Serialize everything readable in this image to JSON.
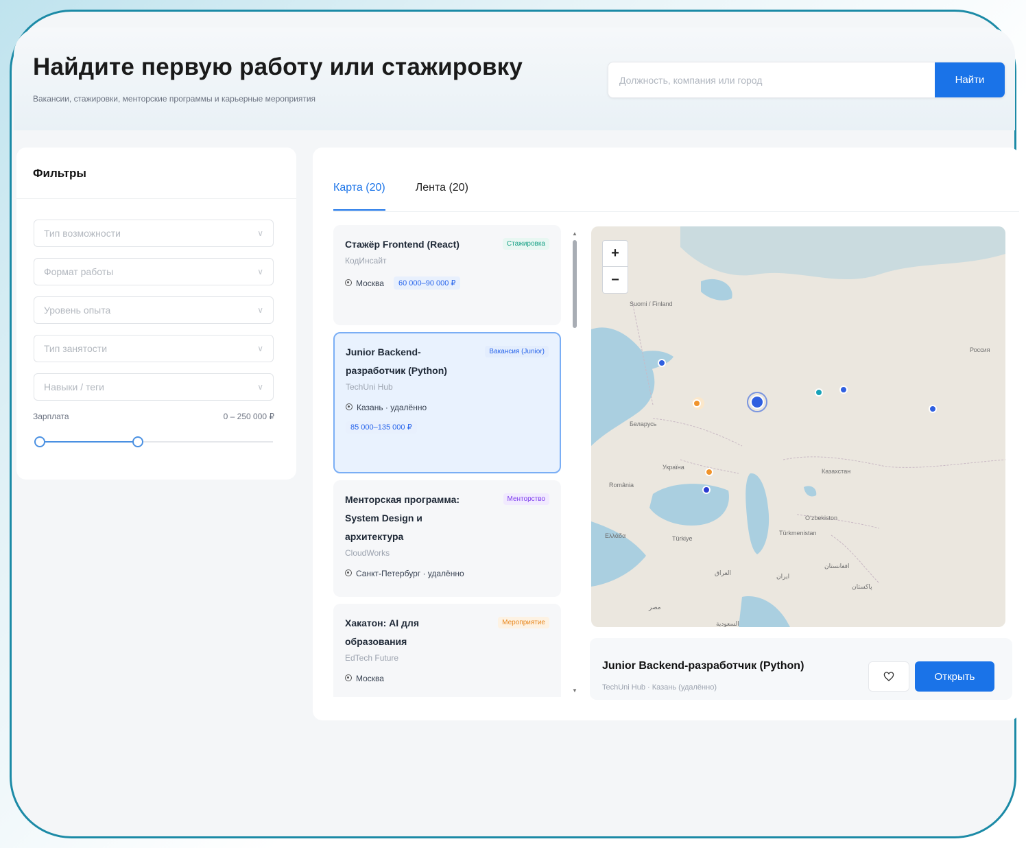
{
  "header": {
    "title": "Найдите первую работу или стажировку",
    "subtitle": "Вакансии, стажировки, менторские программы и карьерные мероприятия"
  },
  "search": {
    "placeholder": "Должность, компания или город",
    "button_label": "Найти"
  },
  "filters": {
    "title": "Фильтры",
    "selects": [
      {
        "placeholder": "Тип возможности"
      },
      {
        "placeholder": "Формат работы"
      },
      {
        "placeholder": "Уровень опыта"
      },
      {
        "placeholder": "Тип занятости"
      },
      {
        "placeholder": "Навыки / теги"
      }
    ],
    "salary": {
      "label": "Зарплата",
      "range_text": "0 – 250 000 ₽",
      "low_fraction": 0.0,
      "high_fraction": 0.42
    }
  },
  "tabs": [
    {
      "label": "Карта (20)",
      "active": true
    },
    {
      "label": "Лента (20)",
      "active": false
    }
  ],
  "listings": [
    {
      "title": "Стажёр Frontend (React)",
      "badge": "Стажировка",
      "company": "КодИнсайт",
      "location": "Москва",
      "salary": "60 000–90 000 ₽"
    },
    {
      "title": "Junior Backend-разработчик (Python)",
      "badge": "Вакансия (Junior)",
      "company": "TechUni Hub",
      "location": "Казань · удалённо",
      "salary": "85 000–135 000 ₽"
    },
    {
      "title": "Менторская программа: System Design и архитектура",
      "badge": "Менторство",
      "company": "CloudWorks",
      "location": "Санкт-Петербург · удалённо",
      "salary": ""
    },
    {
      "title": "Хакатон: AI для образования",
      "badge": "Мероприятие",
      "company": "EdTech Future",
      "location": "Москва",
      "salary": ""
    }
  ],
  "map": {
    "zoom_in": "+",
    "zoom_out": "−",
    "labels": [
      "Suomi / Finland",
      "Беларусь",
      "Україна",
      "România",
      "Türkiye",
      "Казахстан",
      "Oʻzbekiston",
      "Türkmenistan",
      "العراق",
      "ایران",
      "افغانستان",
      "پاکستان",
      "Россия",
      "Ελλάδα",
      "مصر",
      "السعودية"
    ],
    "colors": {
      "vacancy": "#2f5fe0",
      "internship": "#17a2b8",
      "event": "#f0932b",
      "water": "#aacfe0",
      "land": "#ebe7df"
    }
  },
  "selected": {
    "title": "Junior Backend-разработчик (Python)",
    "subtitle": "TechUni Hub · Казань (удалённо)",
    "favorite_icon": "heart-icon",
    "open_label": "Открыть"
  },
  "colors": {
    "accent": "#1a73e8",
    "frame": "#1b8aa6"
  }
}
